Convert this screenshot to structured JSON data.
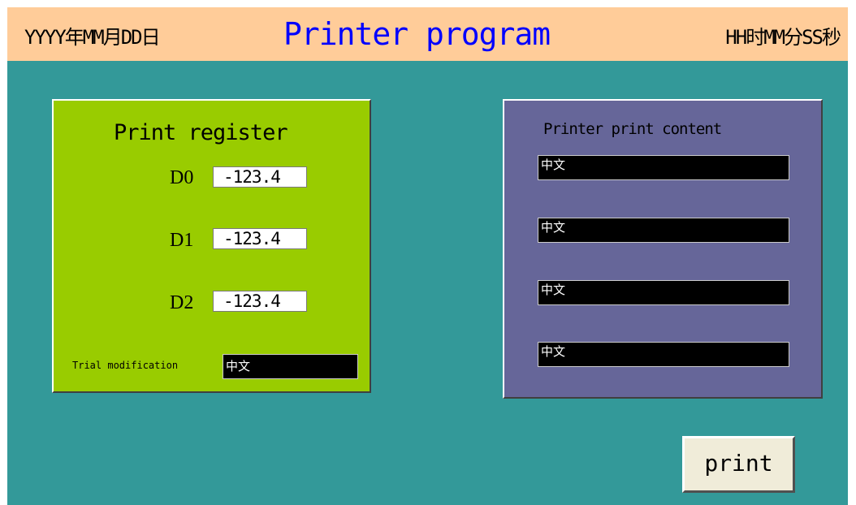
{
  "header": {
    "date": "YYYY年MM月DD日",
    "title": "Printer program",
    "time": "HH时MM分SS秒"
  },
  "register_panel": {
    "title": "Print register",
    "registers": [
      {
        "label": "D0",
        "value": "-123.4"
      },
      {
        "label": "D1",
        "value": "-123.4"
      },
      {
        "label": "D2",
        "value": "-123.4"
      }
    ],
    "trial_label": "Trial modification",
    "trial_value": "中文"
  },
  "content_panel": {
    "title": "Printer print content",
    "fields": [
      "中文",
      "中文",
      "中文",
      "中文"
    ]
  },
  "print_button": {
    "label": "print"
  },
  "colors": {
    "background": "#339999",
    "header": "#ffcc99",
    "title_text": "#0000ff",
    "register_panel": "#99cc00",
    "content_panel": "#666699",
    "button": "#f0ecd9"
  }
}
